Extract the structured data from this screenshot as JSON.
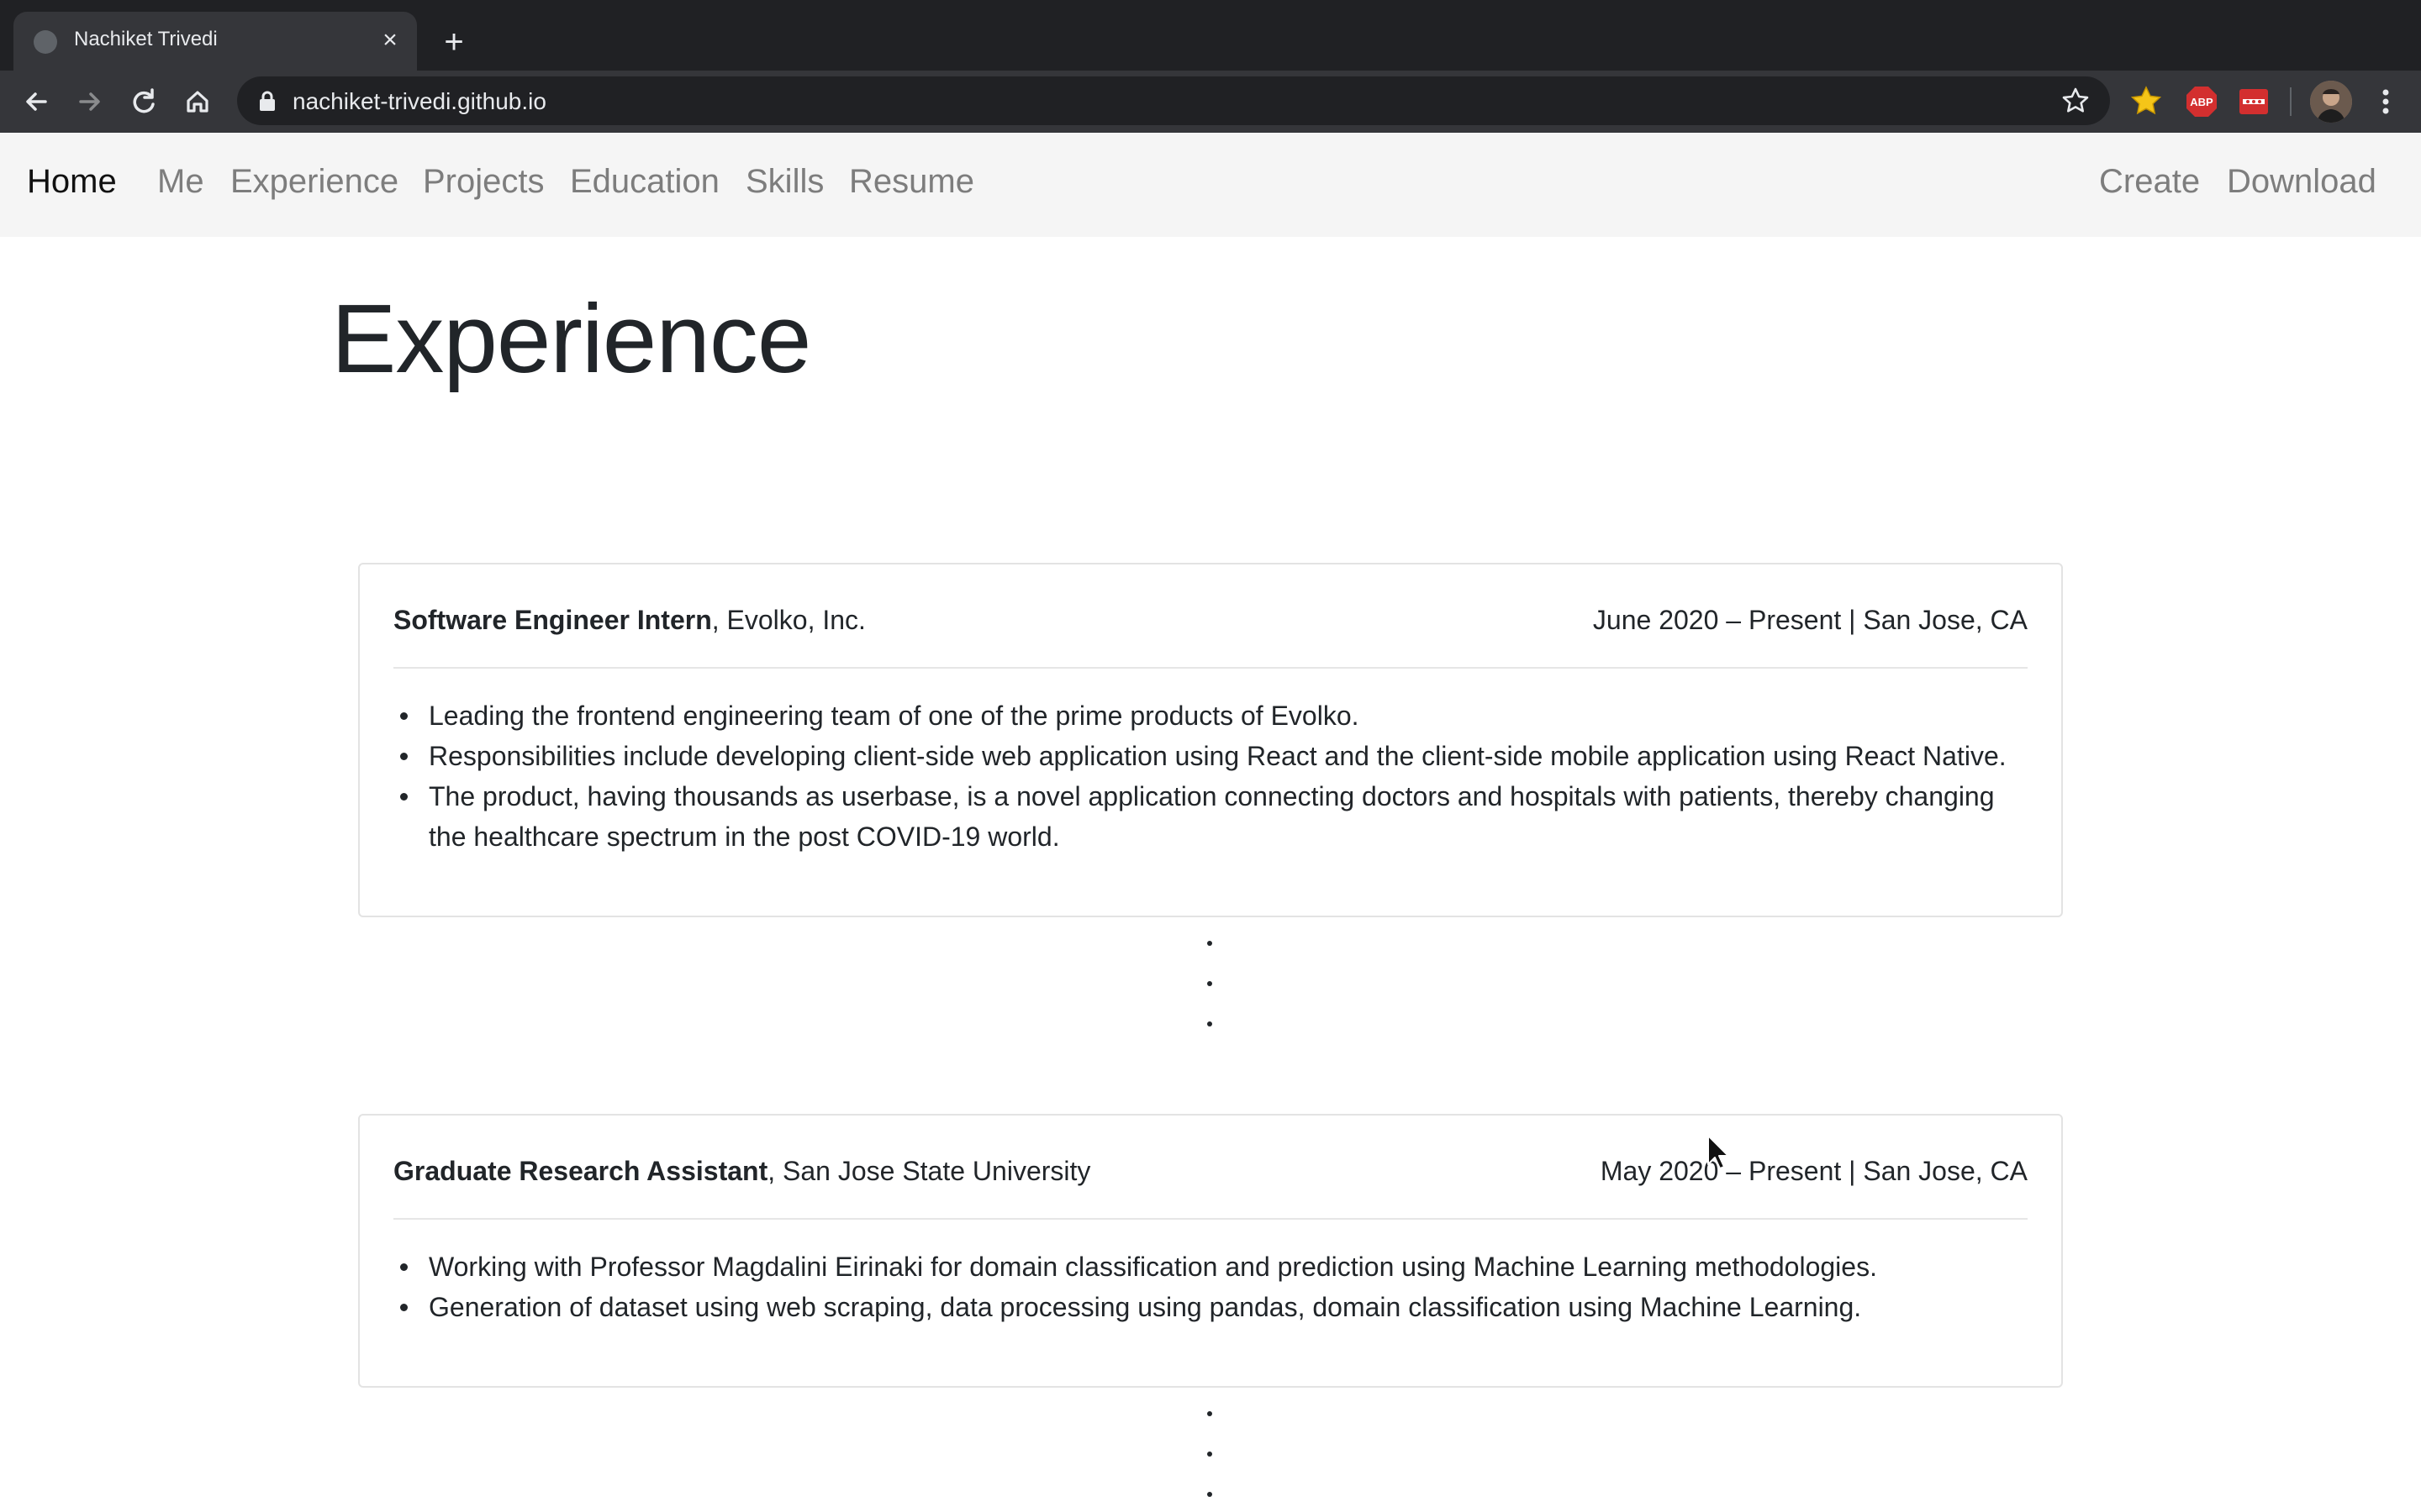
{
  "browser": {
    "tab_title": "Nachiket Trivedi",
    "url": "nachiket-trivedi.github.io",
    "extensions": [
      {
        "name": "favorites-star-icon",
        "color": "#f5c518"
      },
      {
        "name": "adblock-plus-icon",
        "label": "ABP",
        "color": "#d32f2f"
      },
      {
        "name": "extension-red-icon",
        "label": "•••",
        "color": "#d32f2f"
      }
    ]
  },
  "nav": {
    "brand": "Home",
    "links": [
      "Me",
      "Experience",
      "Projects",
      "Education",
      "Skills",
      "Resume"
    ],
    "actions": [
      "Create",
      "Download"
    ]
  },
  "page": {
    "title": "Experience"
  },
  "experience": [
    {
      "role": "Software Engineer Intern",
      "company": ", Evolko, Inc.",
      "meta": "June 2020 – Present  |  San Jose, CA",
      "bullets": [
        "Leading the frontend engineering team of one of the prime products of Evolko.",
        "Responsibilities include developing client-side web application using React and the client-side mobile application using React Native.",
        "The product, having thousands as userbase, is a novel application connecting doctors and hospitals with patients, thereby changing the healthcare spectrum in the post COVID-19 world."
      ]
    },
    {
      "role": "Graduate Research Assistant",
      "company": ", San Jose State University",
      "meta": "May 2020 – Present  |  San Jose, CA",
      "bullets": [
        "Working with Professor Magdalini Eirinaki for domain classification and prediction using Machine Learning methodologies.",
        "Generation of dataset using web scraping, data processing using pandas, domain classification using Machine Learning."
      ]
    }
  ]
}
